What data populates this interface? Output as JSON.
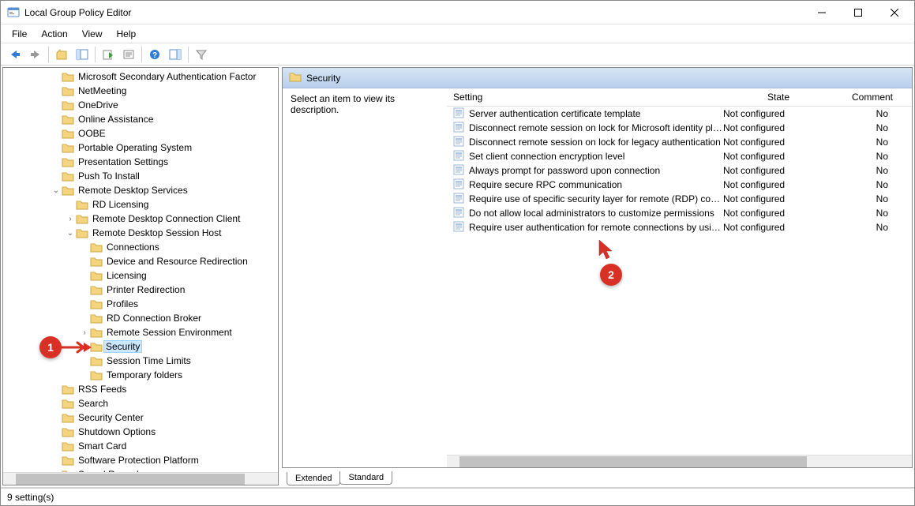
{
  "window": {
    "title": "Local Group Policy Editor"
  },
  "menubar": {
    "file": "File",
    "action": "Action",
    "view": "View",
    "help": "Help"
  },
  "toolbar_icons": [
    "back",
    "forward",
    "up",
    "show-hide-tree",
    "export",
    "properties",
    "help",
    "show-hide-action",
    "filter"
  ],
  "tree": {
    "items_top": [
      "Microsoft Secondary Authentication Factor",
      "NetMeeting",
      "OneDrive",
      "Online Assistance",
      "OOBE",
      "Portable Operating System",
      "Presentation Settings",
      "Push To Install"
    ],
    "rds": "Remote Desktop Services",
    "rd_licensing": "RD Licensing",
    "rd_conn_client": "Remote Desktop Connection Client",
    "rd_session_host": "Remote Desktop Session Host",
    "rdsh_children_pre": [
      "Connections",
      "Device and Resource Redirection",
      "Licensing",
      "Printer Redirection",
      "Profiles",
      "RD Connection Broker"
    ],
    "remote_session_env": "Remote Session Environment",
    "security": "Security",
    "rdsh_children_post": [
      "Session Time Limits",
      "Temporary folders"
    ],
    "items_bottom": [
      "RSS Feeds",
      "Search",
      "Security Center",
      "Shutdown Options",
      "Smart Card",
      "Software Protection Platform",
      "Sound Recorder"
    ]
  },
  "content": {
    "header": "Security",
    "description_prompt": "Select an item to view its description.",
    "columns": {
      "setting": "Setting",
      "state": "State",
      "comment": "Comment"
    },
    "settings": [
      {
        "name": "Server authentication certificate template",
        "state": "Not configured",
        "comment": "No"
      },
      {
        "name": "Disconnect remote session on lock for Microsoft identity pla...",
        "state": "Not configured",
        "comment": "No"
      },
      {
        "name": "Disconnect remote session on lock for legacy authentication",
        "state": "Not configured",
        "comment": "No"
      },
      {
        "name": "Set client connection encryption level",
        "state": "Not configured",
        "comment": "No"
      },
      {
        "name": "Always prompt for password upon connection",
        "state": "Not configured",
        "comment": "No"
      },
      {
        "name": "Require secure RPC communication",
        "state": "Not configured",
        "comment": "No"
      },
      {
        "name": "Require use of specific security layer for remote (RDP) conn...",
        "state": "Not configured",
        "comment": "No"
      },
      {
        "name": "Do not allow local administrators to customize permissions",
        "state": "Not configured",
        "comment": "No"
      },
      {
        "name": "Require user authentication for remote connections by usin...",
        "state": "Not configured",
        "comment": "No"
      }
    ]
  },
  "tabs": {
    "extended": "Extended",
    "standard": "Standard"
  },
  "statusbar": {
    "text": "9 setting(s)"
  },
  "callouts": {
    "c1": "1",
    "c2": "2"
  }
}
